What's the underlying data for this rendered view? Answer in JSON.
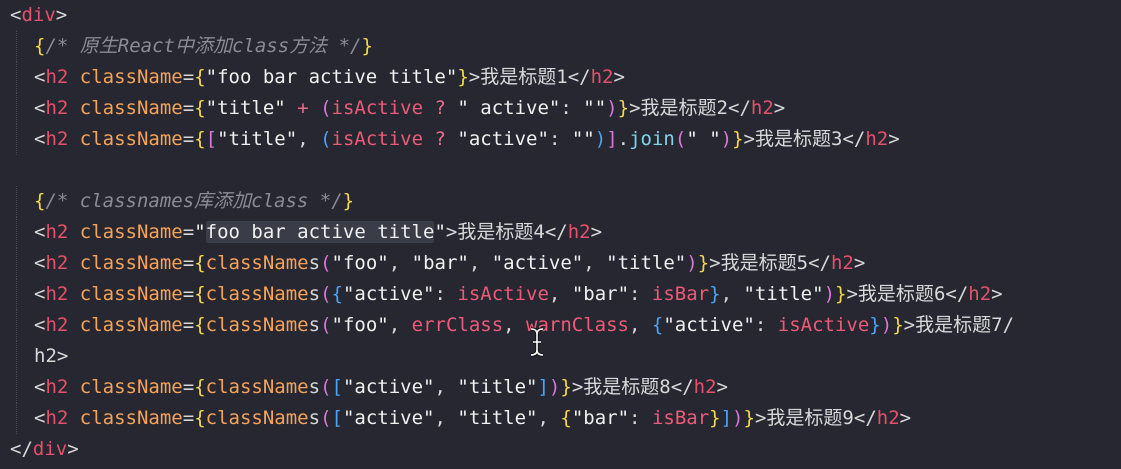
{
  "editor": {
    "language": "jsx",
    "theme": {
      "background": "#262730",
      "tag": "#e5516b",
      "attr": "#f5a35a",
      "func": "#7fd6e8",
      "comment": "#8a8b96"
    },
    "lines": [
      {
        "text": "<div>"
      },
      {
        "text": "{/* 原生React中添加class方法 */}"
      },
      {
        "text": "<h2 className={\"foo bar active title\"}>我是标题1</h2>"
      },
      {
        "text": "<h2 className={\"title\" + (isActive ? \" active\": \"\")}>我是标题2</h2>"
      },
      {
        "text": "<h2 className={[\"title\", (isActive ? \"active\": \"\")].join(\" \")}>我是标题3</h2>"
      },
      {
        "text": ""
      },
      {
        "text": "{/* classnames库添加class */}"
      },
      {
        "text": "<h2 className=\"foo bar active title\">我是标题4</h2>"
      },
      {
        "text": "<h2 className={classNames(\"foo\", \"bar\", \"active\", \"title\")}>我是标题5</h2>"
      },
      {
        "text": "<h2 className={classNames({\"active\": isActive, \"bar\": isBar}, \"title\")}>我是标题6</h2>"
      },
      {
        "text": "<h2 className={classNames(\"foo\", errClass, warnClass, {\"active\": isActive})}>我是标题7</"
      },
      {
        "text": "h2>"
      },
      {
        "text": "<h2 className={classNames([\"active\", \"title\"])}>我是标题8</h2>"
      },
      {
        "text": "<h2 className={classNames([\"active\", \"title\", {\"bar\": isBar}])}>我是标题9</h2>"
      },
      {
        "text": "</div>"
      }
    ]
  },
  "cursor": {
    "icon": "text-cursor-icon"
  }
}
